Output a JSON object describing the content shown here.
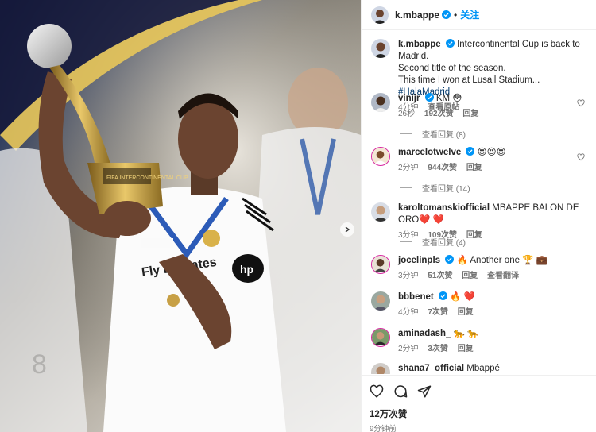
{
  "post": {
    "author": "k.mbappe",
    "follow_label": "关注",
    "caption_line1": "Intercontinental Cup is back to Madrid.",
    "caption_line2": "Second title of the season.",
    "caption_line3": "This time I won at Lusail Stadium...",
    "hashtag": "#HalaMadrid",
    "time": "4分钟",
    "see_translation": "查看原帖",
    "likes": "12万次赞",
    "posted_ago": "9分钟前"
  },
  "comments": [
    {
      "user": "vinijr",
      "text": "KM 😳",
      "time": "26秒",
      "likes": "192次赞",
      "reply": "回复",
      "view_replies": "查看回复 (8)",
      "verified": true
    },
    {
      "user": "marcelotwelve",
      "text": "😍😍😍",
      "time": "2分钟",
      "likes": "944次赞",
      "reply": "回复",
      "view_replies": "查看回复 (14)",
      "verified": true
    },
    {
      "user": "karoltomanskiofficial",
      "text": "MBAPPE BALON DE ORO❤️ ❤️",
      "time": "3分钟",
      "likes": "109次赞",
      "reply": "回复",
      "view_replies": "查看回复 (4)",
      "verified": false
    },
    {
      "user": "jocelinpls",
      "text": "🔥 Another one 🏆 💼",
      "time": "3分钟",
      "likes": "51次赞",
      "reply": "回复",
      "extra": "查看翻译",
      "verified": true
    },
    {
      "user": "bbbenet",
      "text": "🔥 ❤️",
      "time": "4分钟",
      "likes": "7次赞",
      "reply": "回复",
      "verified": true
    },
    {
      "user": "aminadash_",
      "text": "🐆 🐆",
      "time": "2分钟",
      "likes": "3次赞",
      "reply": "回复",
      "verified": false
    },
    {
      "user": "shana7_official",
      "text": "Mbappé",
      "verified": false
    }
  ],
  "photo": {
    "jersey_text": "Fly Emirates",
    "trophy_text": "FIFA INTERCONTINENTAL CUP",
    "sponsor": "hp"
  },
  "colors": {
    "accent": "#0095f6",
    "verified": "#0095f6",
    "muted": "#737373"
  }
}
